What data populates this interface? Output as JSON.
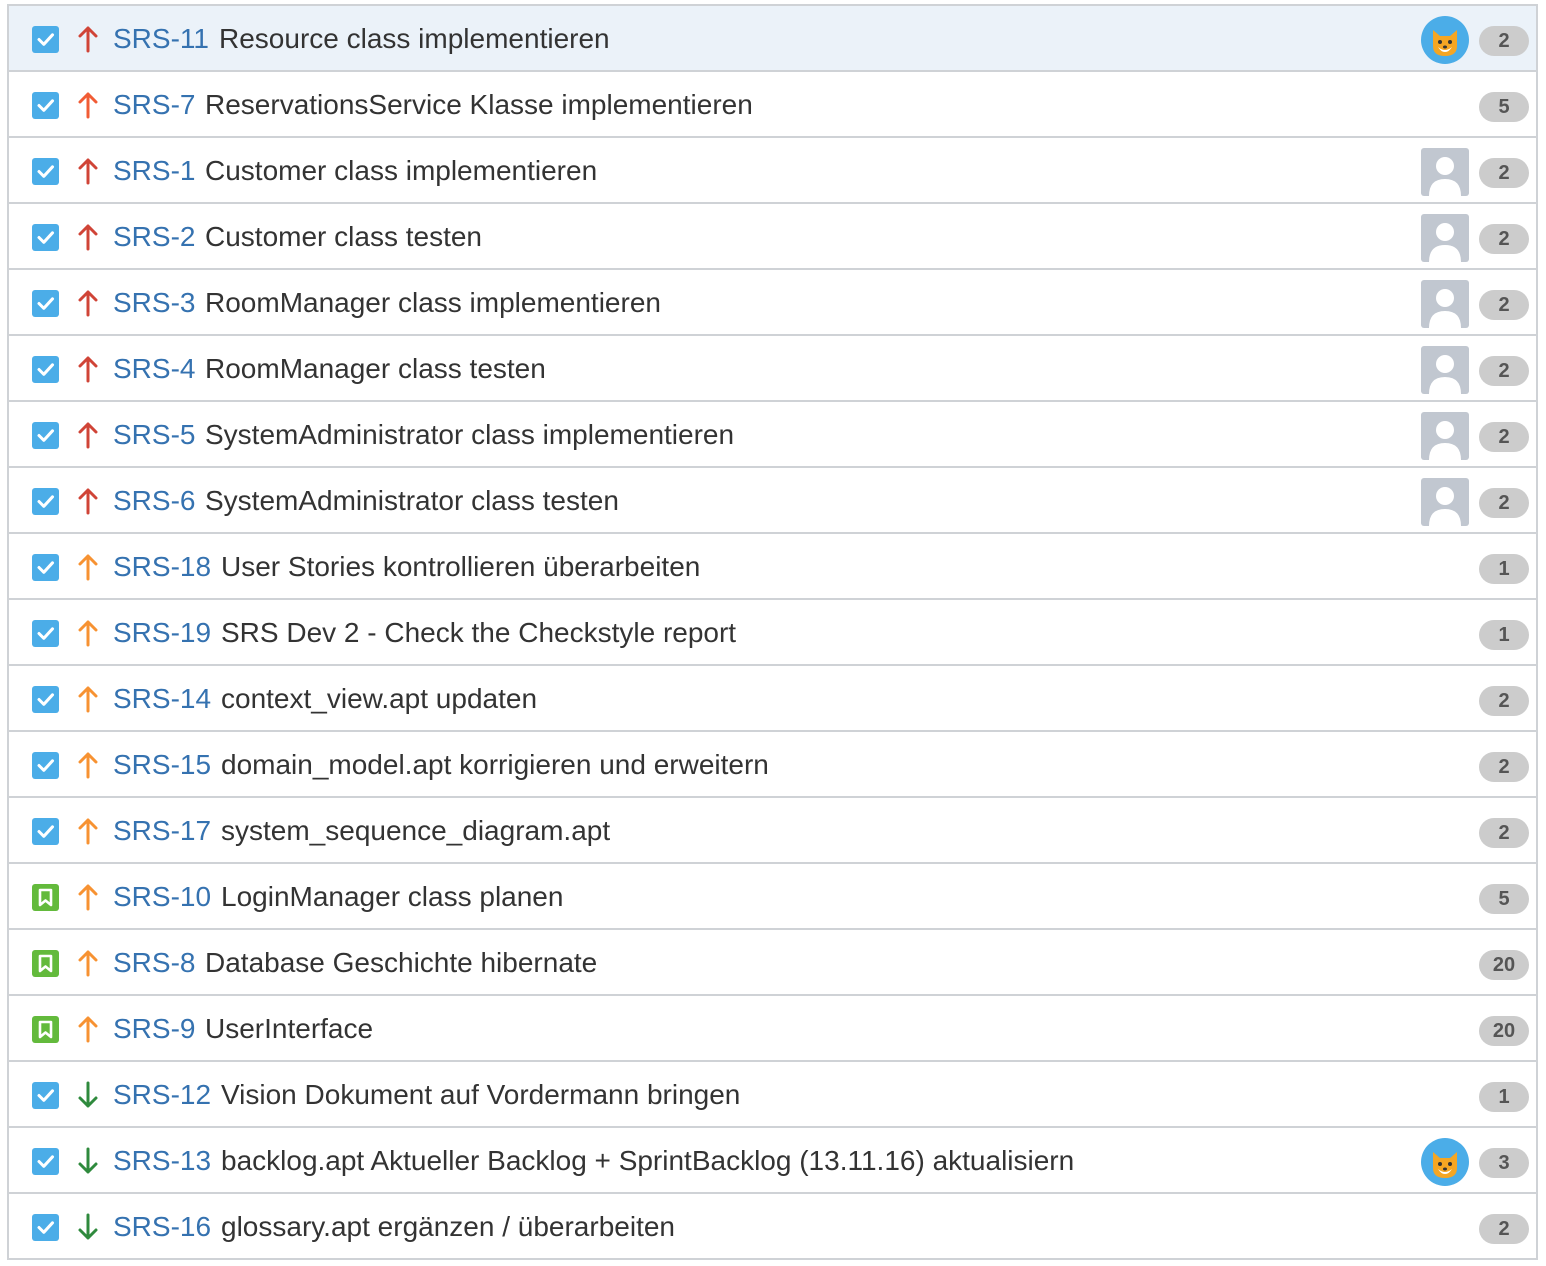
{
  "colors": {
    "link": "#3572b0",
    "text": "#333333",
    "priority_highest": "#d04437",
    "priority_high": "#f15c35",
    "priority_medium": "#f79232",
    "priority_low": "#2f8a3d",
    "task_icon": "#4bade8",
    "story_icon": "#63ba3c",
    "badge": "#cccccc",
    "selected_row": "#ebf2f9"
  },
  "issues": [
    {
      "key": "SRS-11",
      "summary": "Resource class implementieren",
      "type": "task",
      "priority": "highest",
      "avatar": "cat",
      "points": "2",
      "selected": true
    },
    {
      "key": "SRS-7",
      "summary": "ReservationsService Klasse implementieren",
      "type": "task",
      "priority": "high",
      "avatar": "none",
      "points": "5"
    },
    {
      "key": "SRS-1",
      "summary": "Customer class implementieren",
      "type": "task",
      "priority": "highest",
      "avatar": "default",
      "points": "2"
    },
    {
      "key": "SRS-2",
      "summary": "Customer class testen",
      "type": "task",
      "priority": "highest",
      "avatar": "default",
      "points": "2"
    },
    {
      "key": "SRS-3",
      "summary": "RoomManager class implementieren",
      "type": "task",
      "priority": "highest",
      "avatar": "default",
      "points": "2"
    },
    {
      "key": "SRS-4",
      "summary": "RoomManager class testen",
      "type": "task",
      "priority": "highest",
      "avatar": "default",
      "points": "2"
    },
    {
      "key": "SRS-5",
      "summary": "SystemAdministrator class implementieren",
      "type": "task",
      "priority": "highest",
      "avatar": "default",
      "points": "2"
    },
    {
      "key": "SRS-6",
      "summary": "SystemAdministrator class testen",
      "type": "task",
      "priority": "highest",
      "avatar": "default",
      "points": "2"
    },
    {
      "key": "SRS-18",
      "summary": "User Stories kontrollieren überarbeiten",
      "type": "task",
      "priority": "medium",
      "avatar": "none",
      "points": "1"
    },
    {
      "key": "SRS-19",
      "summary": "SRS Dev 2 - Check the Checkstyle report",
      "type": "task",
      "priority": "medium",
      "avatar": "none",
      "points": "1"
    },
    {
      "key": "SRS-14",
      "summary": "context_view.apt updaten",
      "type": "task",
      "priority": "medium",
      "avatar": "none",
      "points": "2"
    },
    {
      "key": "SRS-15",
      "summary": "domain_model.apt korrigieren und erweitern",
      "type": "task",
      "priority": "medium",
      "avatar": "none",
      "points": "2"
    },
    {
      "key": "SRS-17",
      "summary": "system_sequence_diagram.apt",
      "type": "task",
      "priority": "medium",
      "avatar": "none",
      "points": "2"
    },
    {
      "key": "SRS-10",
      "summary": "LoginManager class planen",
      "type": "story",
      "priority": "medium",
      "avatar": "none",
      "points": "5"
    },
    {
      "key": "SRS-8",
      "summary": "Database Geschichte hibernate",
      "type": "story",
      "priority": "medium",
      "avatar": "none",
      "points": "20"
    },
    {
      "key": "SRS-9",
      "summary": "UserInterface",
      "type": "story",
      "priority": "medium",
      "avatar": "none",
      "points": "20"
    },
    {
      "key": "SRS-12",
      "summary": "Vision Dokument auf Vordermann bringen",
      "type": "task",
      "priority": "low",
      "avatar": "none",
      "points": "1"
    },
    {
      "key": "SRS-13",
      "summary": "backlog.apt Aktueller Backlog + SprintBacklog (13.11.16) aktualisiern",
      "type": "task",
      "priority": "low",
      "avatar": "cat",
      "points": "3"
    },
    {
      "key": "SRS-16",
      "summary": "glossary.apt ergänzen / überarbeiten",
      "type": "task",
      "priority": "low",
      "avatar": "none",
      "points": "2"
    }
  ]
}
